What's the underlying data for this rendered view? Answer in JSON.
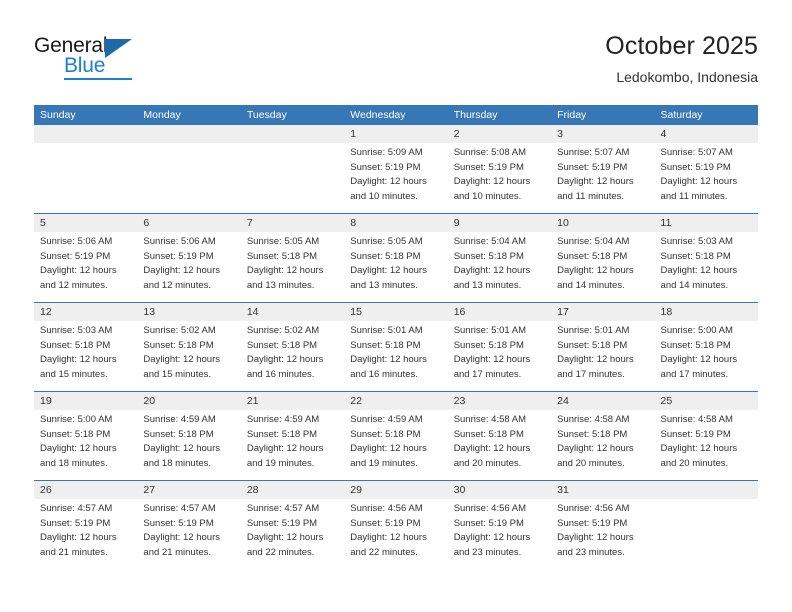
{
  "brand": {
    "name_part1": "General",
    "name_part2": "Blue",
    "accent_color": "#1e7fd4",
    "triangle_color": "#1e6bab"
  },
  "header": {
    "title": "October 2025",
    "subtitle": "Ledokombo, Indonesia"
  },
  "theme": {
    "header_row_bg": "#3877b5",
    "date_band_bg": "#efefef",
    "rule_color": "#3877b5",
    "text_color": "#333333"
  },
  "weekdays": [
    "Sunday",
    "Monday",
    "Tuesday",
    "Wednesday",
    "Thursday",
    "Friday",
    "Saturday"
  ],
  "weeks": [
    {
      "days": [
        {
          "num": "",
          "lines": []
        },
        {
          "num": "",
          "lines": []
        },
        {
          "num": "",
          "lines": []
        },
        {
          "num": "1",
          "lines": [
            "Sunrise: 5:09 AM",
            "Sunset: 5:19 PM",
            "Daylight: 12 hours",
            "and 10 minutes."
          ]
        },
        {
          "num": "2",
          "lines": [
            "Sunrise: 5:08 AM",
            "Sunset: 5:19 PM",
            "Daylight: 12 hours",
            "and 10 minutes."
          ]
        },
        {
          "num": "3",
          "lines": [
            "Sunrise: 5:07 AM",
            "Sunset: 5:19 PM",
            "Daylight: 12 hours",
            "and 11 minutes."
          ]
        },
        {
          "num": "4",
          "lines": [
            "Sunrise: 5:07 AM",
            "Sunset: 5:19 PM",
            "Daylight: 12 hours",
            "and 11 minutes."
          ]
        }
      ]
    },
    {
      "days": [
        {
          "num": "5",
          "lines": [
            "Sunrise: 5:06 AM",
            "Sunset: 5:19 PM",
            "Daylight: 12 hours",
            "and 12 minutes."
          ]
        },
        {
          "num": "6",
          "lines": [
            "Sunrise: 5:06 AM",
            "Sunset: 5:19 PM",
            "Daylight: 12 hours",
            "and 12 minutes."
          ]
        },
        {
          "num": "7",
          "lines": [
            "Sunrise: 5:05 AM",
            "Sunset: 5:18 PM",
            "Daylight: 12 hours",
            "and 13 minutes."
          ]
        },
        {
          "num": "8",
          "lines": [
            "Sunrise: 5:05 AM",
            "Sunset: 5:18 PM",
            "Daylight: 12 hours",
            "and 13 minutes."
          ]
        },
        {
          "num": "9",
          "lines": [
            "Sunrise: 5:04 AM",
            "Sunset: 5:18 PM",
            "Daylight: 12 hours",
            "and 13 minutes."
          ]
        },
        {
          "num": "10",
          "lines": [
            "Sunrise: 5:04 AM",
            "Sunset: 5:18 PM",
            "Daylight: 12 hours",
            "and 14 minutes."
          ]
        },
        {
          "num": "11",
          "lines": [
            "Sunrise: 5:03 AM",
            "Sunset: 5:18 PM",
            "Daylight: 12 hours",
            "and 14 minutes."
          ]
        }
      ]
    },
    {
      "days": [
        {
          "num": "12",
          "lines": [
            "Sunrise: 5:03 AM",
            "Sunset: 5:18 PM",
            "Daylight: 12 hours",
            "and 15 minutes."
          ]
        },
        {
          "num": "13",
          "lines": [
            "Sunrise: 5:02 AM",
            "Sunset: 5:18 PM",
            "Daylight: 12 hours",
            "and 15 minutes."
          ]
        },
        {
          "num": "14",
          "lines": [
            "Sunrise: 5:02 AM",
            "Sunset: 5:18 PM",
            "Daylight: 12 hours",
            "and 16 minutes."
          ]
        },
        {
          "num": "15",
          "lines": [
            "Sunrise: 5:01 AM",
            "Sunset: 5:18 PM",
            "Daylight: 12 hours",
            "and 16 minutes."
          ]
        },
        {
          "num": "16",
          "lines": [
            "Sunrise: 5:01 AM",
            "Sunset: 5:18 PM",
            "Daylight: 12 hours",
            "and 17 minutes."
          ]
        },
        {
          "num": "17",
          "lines": [
            "Sunrise: 5:01 AM",
            "Sunset: 5:18 PM",
            "Daylight: 12 hours",
            "and 17 minutes."
          ]
        },
        {
          "num": "18",
          "lines": [
            "Sunrise: 5:00 AM",
            "Sunset: 5:18 PM",
            "Daylight: 12 hours",
            "and 17 minutes."
          ]
        }
      ]
    },
    {
      "days": [
        {
          "num": "19",
          "lines": [
            "Sunrise: 5:00 AM",
            "Sunset: 5:18 PM",
            "Daylight: 12 hours",
            "and 18 minutes."
          ]
        },
        {
          "num": "20",
          "lines": [
            "Sunrise: 4:59 AM",
            "Sunset: 5:18 PM",
            "Daylight: 12 hours",
            "and 18 minutes."
          ]
        },
        {
          "num": "21",
          "lines": [
            "Sunrise: 4:59 AM",
            "Sunset: 5:18 PM",
            "Daylight: 12 hours",
            "and 19 minutes."
          ]
        },
        {
          "num": "22",
          "lines": [
            "Sunrise: 4:59 AM",
            "Sunset: 5:18 PM",
            "Daylight: 12 hours",
            "and 19 minutes."
          ]
        },
        {
          "num": "23",
          "lines": [
            "Sunrise: 4:58 AM",
            "Sunset: 5:18 PM",
            "Daylight: 12 hours",
            "and 20 minutes."
          ]
        },
        {
          "num": "24",
          "lines": [
            "Sunrise: 4:58 AM",
            "Sunset: 5:18 PM",
            "Daylight: 12 hours",
            "and 20 minutes."
          ]
        },
        {
          "num": "25",
          "lines": [
            "Sunrise: 4:58 AM",
            "Sunset: 5:19 PM",
            "Daylight: 12 hours",
            "and 20 minutes."
          ]
        }
      ]
    },
    {
      "days": [
        {
          "num": "26",
          "lines": [
            "Sunrise: 4:57 AM",
            "Sunset: 5:19 PM",
            "Daylight: 12 hours",
            "and 21 minutes."
          ]
        },
        {
          "num": "27",
          "lines": [
            "Sunrise: 4:57 AM",
            "Sunset: 5:19 PM",
            "Daylight: 12 hours",
            "and 21 minutes."
          ]
        },
        {
          "num": "28",
          "lines": [
            "Sunrise: 4:57 AM",
            "Sunset: 5:19 PM",
            "Daylight: 12 hours",
            "and 22 minutes."
          ]
        },
        {
          "num": "29",
          "lines": [
            "Sunrise: 4:56 AM",
            "Sunset: 5:19 PM",
            "Daylight: 12 hours",
            "and 22 minutes."
          ]
        },
        {
          "num": "30",
          "lines": [
            "Sunrise: 4:56 AM",
            "Sunset: 5:19 PM",
            "Daylight: 12 hours",
            "and 23 minutes."
          ]
        },
        {
          "num": "31",
          "lines": [
            "Sunrise: 4:56 AM",
            "Sunset: 5:19 PM",
            "Daylight: 12 hours",
            "and 23 minutes."
          ]
        },
        {
          "num": "",
          "lines": []
        }
      ]
    }
  ]
}
